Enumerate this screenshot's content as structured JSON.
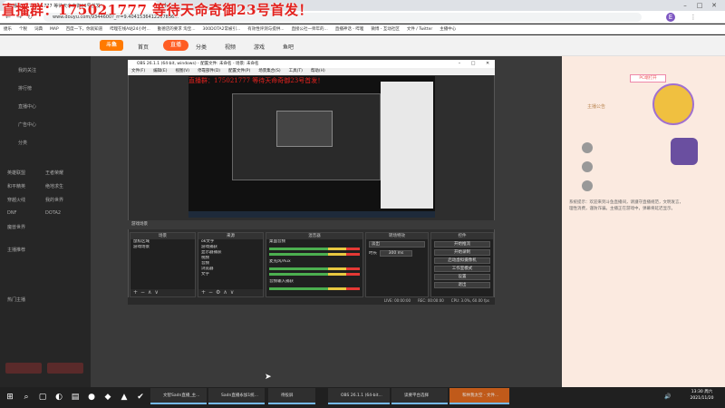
{
  "overlay": {
    "title": "直播群：175021777 等待天命奇御23号首发！"
  },
  "browser": {
    "tab_title": "直播群：175021777 等待天命奇御23号首发！",
    "url": "www.douyu.com/9344600?_rr=9.4041536412267836...",
    "bookmarks": [
      "捷乐",
      "个税",
      "词典",
      "MAP",
      "百度一下，你就知道",
      "哔哩在线A站24小时...",
      "勤德店的要求 淘宝...",
      "300DOTA2常被引...",
      "有效性评测与提供...",
      "直接公社一师年的...",
      "直播神话 - 哔哩",
      "微博 - 互动社区",
      "文件 / Twitter",
      "主播中心"
    ],
    "profile_badge": "E"
  },
  "douyu": {
    "logo": "斗鱼",
    "nav": [
      "首页",
      "直播",
      "分类",
      "视频",
      "游戏",
      "鱼吧"
    ],
    "sidebar": [
      "我的关注",
      "排行榜",
      "直播中心",
      "广告中心",
      "分类",
      "英雄联盟",
      "王者荣耀",
      "和平精英",
      "绝地求生",
      "穿越火线",
      "我的世界",
      "DNF",
      "DOTA2",
      "魔兽世界",
      "主播推荐",
      "热门主播"
    ],
    "right_panel_title": "主播公告",
    "chat_notice": "系统提示：欢迎来到斗鱼直播间，请遵守直播规范，文明发言，理性消费，谨防诈骗。主播正在游戏中，弹幕将延迟显示。",
    "follow_count": "PC端打开"
  },
  "obs": {
    "titlebar": "OBS 26.1.1 (64-bit, windows) - 配置文件: 未命名 - 场景: 未命名",
    "menu": [
      "文件(F)",
      "编辑(E)",
      "视图(V)",
      "停靠部件(D)",
      "配置文件(P)",
      "场景集合(S)",
      "工具(T)",
      "帮助(H)"
    ],
    "preview_title": "直播群：175021777 等待天命奇御23号首发！",
    "scenebar_label": "游戏场景",
    "scenes_header": "场景",
    "scenes": [
      "鼠标区域",
      "游戏场景"
    ],
    "sources_header": "来源",
    "sources": [
      "ok文字",
      "游戏捕获",
      "显示器捕获",
      "视频",
      "音频",
      "浏览器",
      "文字"
    ],
    "mixer_header": "混音器",
    "mixer": [
      "桌面音频",
      "麦克风/Aux",
      "音频输入捕获"
    ],
    "transitions_header": "转场特效",
    "transition_value": "淡出",
    "duration_label": "时长",
    "duration_value": "300 ms",
    "controls_header": "控件",
    "controls": [
      "开始推流",
      "开始录制",
      "启动虚拟摄像机",
      "工作室模式",
      "设置",
      "退出"
    ],
    "status": [
      "LIVE: 00:00:00",
      "REC: 00:00:00",
      "CPU: 3.0%, 60.00 fps"
    ]
  },
  "taskbar": {
    "apps": [
      "文智Sadn直播_主...",
      "Sadn直播永加1统...",
      "待投屏",
      "OBS 26.1.1 (64-bit...",
      "读要平台选择",
      "和林我太空 - 文件..."
    ],
    "time": "13:30 周六",
    "date": "2021/11/20"
  }
}
